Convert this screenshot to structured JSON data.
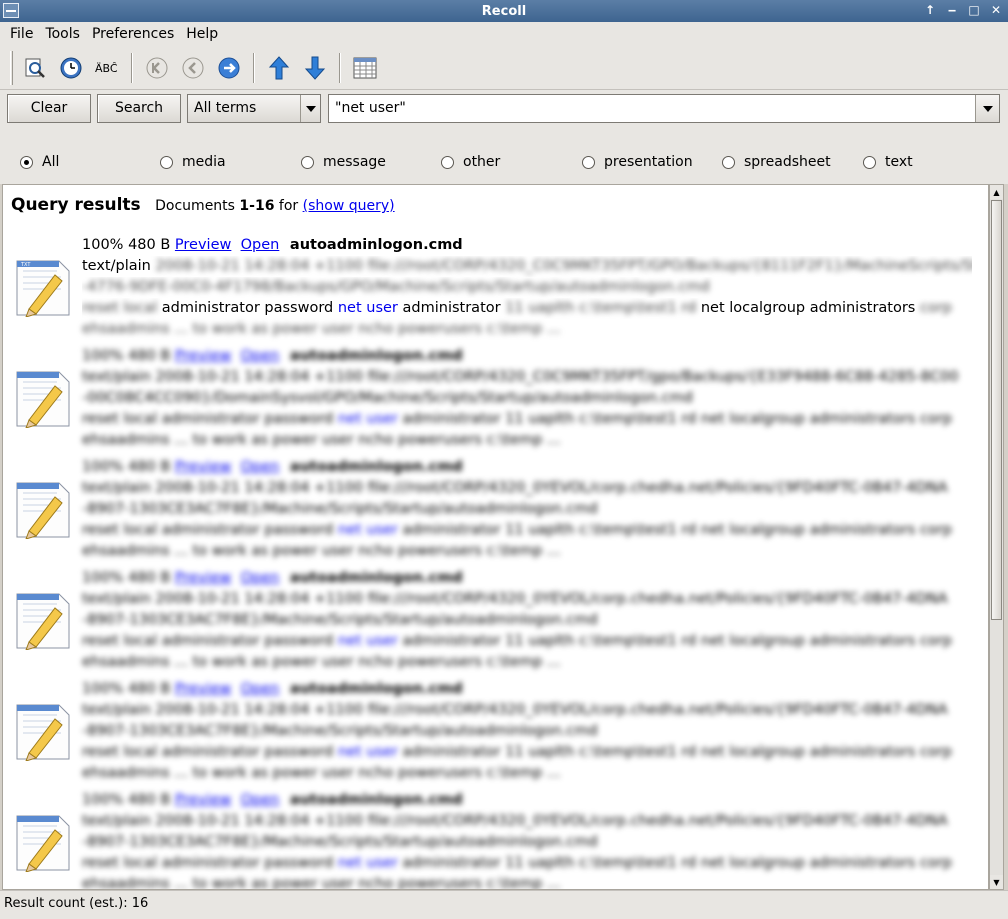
{
  "window": {
    "title": "Recoll"
  },
  "menu": {
    "file": "File",
    "tools": "Tools",
    "preferences": "Preferences",
    "help": "Help"
  },
  "search": {
    "clear_label": "Clear",
    "search_label": "Search",
    "mode": "All terms",
    "query": "\"net user\""
  },
  "filters": {
    "all": "All",
    "media": "media",
    "message": "message",
    "other": "other",
    "presentation": "presentation",
    "spreadsheet": "spreadsheet",
    "text": "text",
    "selected": "All"
  },
  "results": {
    "title": "Query results",
    "docs_prefix": "Documents",
    "docs_range": "1-16",
    "docs_for": "for",
    "show_query": "(show query)",
    "items": [
      {
        "relevance": "100% 480 B",
        "preview": "Preview",
        "open": "Open",
        "filename": "autoadminlogon.cmd",
        "mime": "text/plain",
        "meta_blurred": "2008-10-21 14:28:04 +1100  file:///root/CORP/4320_C0C9MKT35FPT/GPO/Backups/{8111F2F1}/MachineScripts/Startup/autoadminlogon.cmd",
        "snippet_pre_blur": "reset local",
        "snippet_a": "administrator password",
        "snippet_hl": "net user",
        "snippet_b": "administrator",
        "snippet_mid_blur": "11 uaplth c:\\temp\\test1 rd",
        "snippet_c": "net localgroup administrators",
        "snippet_post_blur": "corp",
        "line4_blurred": "ehsaadmins ... to work as power user ncho powerusers c:\\temp ..."
      },
      {
        "relevance": "100% 480 B",
        "preview": "Preview",
        "open": "Open",
        "filename": "autoadminlogon.cmd",
        "meta_blurred": "text/plain 2008-10-21 14:28:04 +1100 file:///root/CORP/4320_C0C9MKT35FPT/gpo/Backups/{E33F9488-6C88-4285-8C00",
        "path_blurred": "-00C08C4CC090}/DomainSysvol/GPO/Machine/Scripts/Startup/autoadminlogon.cmd",
        "snippet_pre": "reset local administrator password",
        "snippet_hl": "net user",
        "snippet_post": "administrator 11 uaplth c:\\temp\\test1 rd net localgroup administrators corp",
        "line4_blurred": "ehsaadmins ... to work as power user ncho powerusers c:\\temp ..."
      },
      {
        "relevance": "100% 480 B",
        "preview": "Preview",
        "open": "Open",
        "filename": "autoadminlogon.cmd",
        "meta_blurred": "text/plain 2008-10-21 14:28:04 +1100 file:///root/CORP/4320_0YEVOL/corp.chedha.net/Policies/{9FD40FTC-0B47-4DNA",
        "path_blurred": "-8907-1303CE3AC7F8E}/Machine/Scripts/Startup/autoadminlogon.cmd",
        "snippet_pre": "reset local administrator password",
        "snippet_hl": "net user",
        "snippet_post": "administrator 11 uaplth c:\\temp\\test1 rd net localgroup administrators corp",
        "line4_blurred": "ehsaadmins ... to work as power user ncho powerusers c:\\temp ..."
      },
      {
        "relevance": "100% 480 B",
        "preview": "Preview",
        "open": "Open",
        "filename": "autoadminlogon.cmd",
        "meta_blurred": "text/plain 2008-10-21 14:28:04 +1100 file:///root/CORP/4320_0YEVOL/corp.chedha.net/Policies/{9FD40FTC-0B47-4DNA",
        "path_blurred": "-8907-1303CE3AC7F8E}/Machine/Scripts/Startup/autoadminlogon.cmd",
        "snippet_pre": "reset local administrator password",
        "snippet_hl": "net user",
        "snippet_post": "administrator 11 uaplth c:\\temp\\test1 rd net localgroup administrators corp",
        "line4_blurred": "ehsaadmins ... to work as power user ncho powerusers c:\\temp ..."
      },
      {
        "relevance": "100% 480 B",
        "preview": "Preview",
        "open": "Open",
        "filename": "autoadminlogon.cmd",
        "meta_blurred": "text/plain 2008-10-21 14:28:04 +1100 file:///root/CORP/4320_0YEVOL/corp.chedha.net/Policies/{9FD40FTC-0B47-4DNA",
        "path_blurred": "-8907-1303CE3AC7F8E}/Machine/Scripts/Startup/autoadminlogon.cmd",
        "snippet_pre": "reset local administrator password",
        "snippet_hl": "net user",
        "snippet_post": "administrator 11 uaplth c:\\temp\\test1 rd net localgroup administrators corp",
        "line4_blurred": "ehsaadmins ... to work as power user ncho powerusers c:\\temp ..."
      },
      {
        "relevance": "100% 480 B",
        "preview": "Preview",
        "open": "Open",
        "filename": "autoadminlogon.cmd",
        "meta_blurred": "text/plain 2008-10-21 14:28:04 +1100 file:///root/CORP/4320_0YEVOL/corp.chedha.net/Policies/{9FD40FTC-0B47-4DNA",
        "path_blurred": "-8907-1303CE3AC7F8E}/Machine/Scripts/Startup/autoadminlogon.cmd",
        "snippet_pre": "reset local administrator password",
        "snippet_hl": "net user",
        "snippet_post": "administrator 11 uaplth c:\\temp\\test1 rd net localgroup administrators corp",
        "line4_blurred": "ehsaadmins ... to work as power user ncho powerusers c:\\temp ..."
      }
    ]
  },
  "status": {
    "text": "Result count (est.): 16"
  }
}
